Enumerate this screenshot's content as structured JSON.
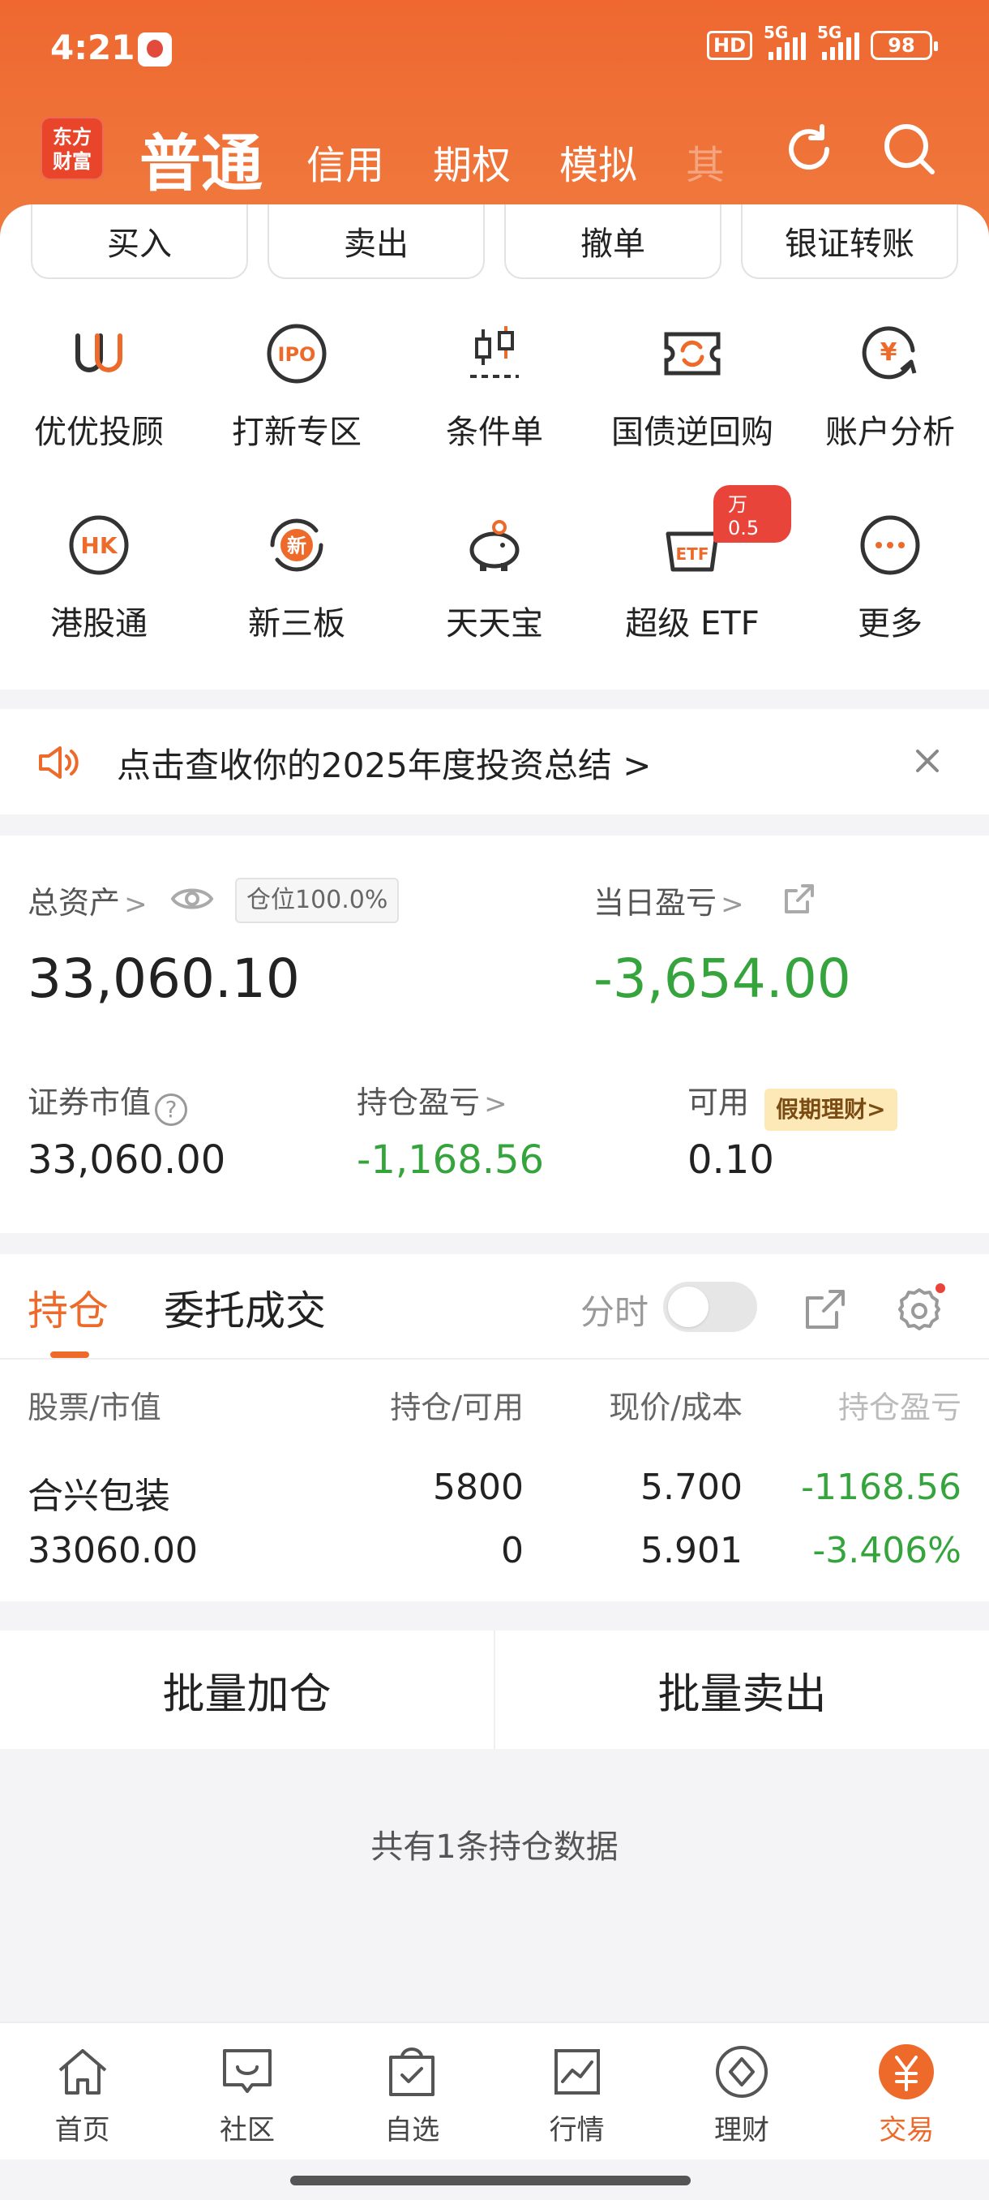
{
  "status_bar": {
    "time": "4:21",
    "hd": "HD",
    "sim1": "5G",
    "sim2": "5G",
    "battery": "98"
  },
  "brand": {
    "line1": "东方",
    "line2": "财富"
  },
  "nav": {
    "active": "普通",
    "tabs": [
      "信用",
      "期权",
      "模拟"
    ],
    "faded": "其"
  },
  "quick_actions": [
    "买入",
    "卖出",
    "撤单",
    "银证转账"
  ],
  "grid": [
    {
      "label": "优优投顾",
      "icon": "youyou-advisor-icon"
    },
    {
      "label": "打新专区",
      "icon": "ipo-icon"
    },
    {
      "label": "条件单",
      "icon": "candlestick-icon"
    },
    {
      "label": "国债逆回购",
      "icon": "repo-ticket-icon"
    },
    {
      "label": "账户分析",
      "icon": "account-analysis-icon"
    },
    {
      "label": "港股通",
      "icon": "hk-icon"
    },
    {
      "label": "新三板",
      "icon": "new-third-board-icon"
    },
    {
      "label": "天天宝",
      "icon": "piggy-bank-icon"
    },
    {
      "label": "超级 ETF",
      "icon": "etf-basket-icon",
      "badge": "万0.5"
    },
    {
      "label": "更多",
      "icon": "more-icon"
    }
  ],
  "banner": {
    "text": "点击查收你的2025年度投资总结 >"
  },
  "assets": {
    "total_label": "总资产",
    "position_badge": "仓位100.0%",
    "total_value": "33,060.10",
    "daily_pl_label": "当日盈亏",
    "daily_pl_value": "-3,654.00",
    "market_value_label": "证券市值",
    "market_value": "33,060.00",
    "holding_pl_label": "持仓盈亏",
    "holding_pl_value": "-1,168.56",
    "available_label": "可用",
    "available_tag": "假期理财>",
    "available_value": "0.10"
  },
  "positions": {
    "tab_holdings": "持仓",
    "tab_orders": "委托成交",
    "fenshi": "分时",
    "headers": [
      "股票/市值",
      "持仓/可用",
      "现价/成本",
      "持仓盈亏"
    ],
    "rows": [
      {
        "name": "合兴包装",
        "market_value": "33060.00",
        "qty": "5800",
        "available": "0",
        "price": "5.700",
        "cost": "5.901",
        "pl": "-1168.56",
        "pl_pct": "-3.406%"
      }
    ]
  },
  "batch": {
    "add": "批量加仓",
    "sell": "批量卖出"
  },
  "count_text": "共有1条持仓数据",
  "bottom_nav": [
    "首页",
    "社区",
    "自选",
    "行情",
    "理财",
    "交易"
  ],
  "colors": {
    "brand_orange": "#EE6A2A",
    "loss_green": "#36A43C"
  }
}
